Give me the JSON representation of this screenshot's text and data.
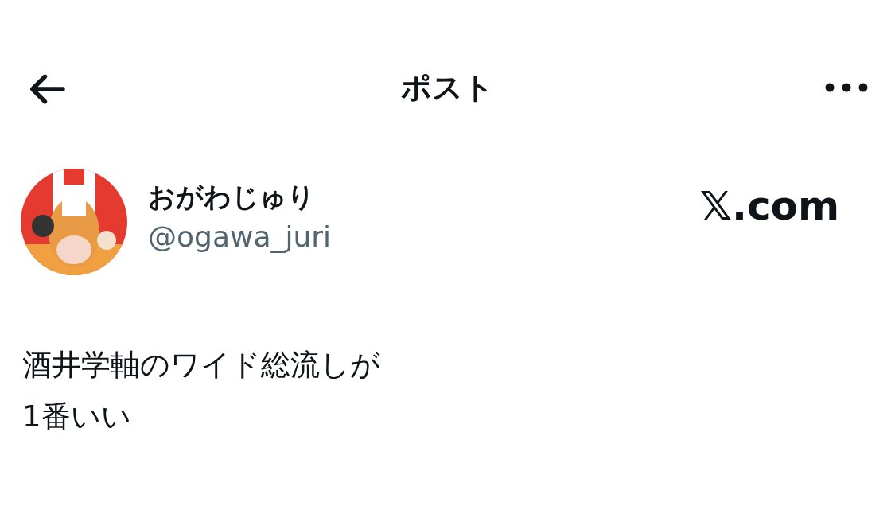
{
  "header": {
    "title": "ポスト"
  },
  "author": {
    "name": "おがわじゅり",
    "handle": "@ogawa_juri"
  },
  "watermark_site": "𝕏.com",
  "body": [
    "酒井学軸のワイド総流しが",
    "1番いい"
  ]
}
